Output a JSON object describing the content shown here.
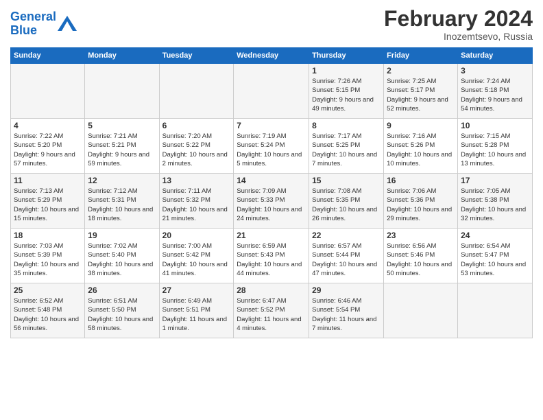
{
  "header": {
    "logo_line1": "General",
    "logo_line2": "Blue",
    "month_title": "February 2024",
    "location": "Inozemtsevo, Russia"
  },
  "weekdays": [
    "Sunday",
    "Monday",
    "Tuesday",
    "Wednesday",
    "Thursday",
    "Friday",
    "Saturday"
  ],
  "weeks": [
    [
      {
        "day": "",
        "info": ""
      },
      {
        "day": "",
        "info": ""
      },
      {
        "day": "",
        "info": ""
      },
      {
        "day": "",
        "info": ""
      },
      {
        "day": "1",
        "info": "Sunrise: 7:26 AM\nSunset: 5:15 PM\nDaylight: 9 hours\nand 49 minutes."
      },
      {
        "day": "2",
        "info": "Sunrise: 7:25 AM\nSunset: 5:17 PM\nDaylight: 9 hours\nand 52 minutes."
      },
      {
        "day": "3",
        "info": "Sunrise: 7:24 AM\nSunset: 5:18 PM\nDaylight: 9 hours\nand 54 minutes."
      }
    ],
    [
      {
        "day": "4",
        "info": "Sunrise: 7:22 AM\nSunset: 5:20 PM\nDaylight: 9 hours\nand 57 minutes."
      },
      {
        "day": "5",
        "info": "Sunrise: 7:21 AM\nSunset: 5:21 PM\nDaylight: 9 hours\nand 59 minutes."
      },
      {
        "day": "6",
        "info": "Sunrise: 7:20 AM\nSunset: 5:22 PM\nDaylight: 10 hours\nand 2 minutes."
      },
      {
        "day": "7",
        "info": "Sunrise: 7:19 AM\nSunset: 5:24 PM\nDaylight: 10 hours\nand 5 minutes."
      },
      {
        "day": "8",
        "info": "Sunrise: 7:17 AM\nSunset: 5:25 PM\nDaylight: 10 hours\nand 7 minutes."
      },
      {
        "day": "9",
        "info": "Sunrise: 7:16 AM\nSunset: 5:26 PM\nDaylight: 10 hours\nand 10 minutes."
      },
      {
        "day": "10",
        "info": "Sunrise: 7:15 AM\nSunset: 5:28 PM\nDaylight: 10 hours\nand 13 minutes."
      }
    ],
    [
      {
        "day": "11",
        "info": "Sunrise: 7:13 AM\nSunset: 5:29 PM\nDaylight: 10 hours\nand 15 minutes."
      },
      {
        "day": "12",
        "info": "Sunrise: 7:12 AM\nSunset: 5:31 PM\nDaylight: 10 hours\nand 18 minutes."
      },
      {
        "day": "13",
        "info": "Sunrise: 7:11 AM\nSunset: 5:32 PM\nDaylight: 10 hours\nand 21 minutes."
      },
      {
        "day": "14",
        "info": "Sunrise: 7:09 AM\nSunset: 5:33 PM\nDaylight: 10 hours\nand 24 minutes."
      },
      {
        "day": "15",
        "info": "Sunrise: 7:08 AM\nSunset: 5:35 PM\nDaylight: 10 hours\nand 26 minutes."
      },
      {
        "day": "16",
        "info": "Sunrise: 7:06 AM\nSunset: 5:36 PM\nDaylight: 10 hours\nand 29 minutes."
      },
      {
        "day": "17",
        "info": "Sunrise: 7:05 AM\nSunset: 5:38 PM\nDaylight: 10 hours\nand 32 minutes."
      }
    ],
    [
      {
        "day": "18",
        "info": "Sunrise: 7:03 AM\nSunset: 5:39 PM\nDaylight: 10 hours\nand 35 minutes."
      },
      {
        "day": "19",
        "info": "Sunrise: 7:02 AM\nSunset: 5:40 PM\nDaylight: 10 hours\nand 38 minutes."
      },
      {
        "day": "20",
        "info": "Sunrise: 7:00 AM\nSunset: 5:42 PM\nDaylight: 10 hours\nand 41 minutes."
      },
      {
        "day": "21",
        "info": "Sunrise: 6:59 AM\nSunset: 5:43 PM\nDaylight: 10 hours\nand 44 minutes."
      },
      {
        "day": "22",
        "info": "Sunrise: 6:57 AM\nSunset: 5:44 PM\nDaylight: 10 hours\nand 47 minutes."
      },
      {
        "day": "23",
        "info": "Sunrise: 6:56 AM\nSunset: 5:46 PM\nDaylight: 10 hours\nand 50 minutes."
      },
      {
        "day": "24",
        "info": "Sunrise: 6:54 AM\nSunset: 5:47 PM\nDaylight: 10 hours\nand 53 minutes."
      }
    ],
    [
      {
        "day": "25",
        "info": "Sunrise: 6:52 AM\nSunset: 5:48 PM\nDaylight: 10 hours\nand 56 minutes."
      },
      {
        "day": "26",
        "info": "Sunrise: 6:51 AM\nSunset: 5:50 PM\nDaylight: 10 hours\nand 58 minutes."
      },
      {
        "day": "27",
        "info": "Sunrise: 6:49 AM\nSunset: 5:51 PM\nDaylight: 11 hours\nand 1 minute."
      },
      {
        "day": "28",
        "info": "Sunrise: 6:47 AM\nSunset: 5:52 PM\nDaylight: 11 hours\nand 4 minutes."
      },
      {
        "day": "29",
        "info": "Sunrise: 6:46 AM\nSunset: 5:54 PM\nDaylight: 11 hours\nand 7 minutes."
      },
      {
        "day": "",
        "info": ""
      },
      {
        "day": "",
        "info": ""
      }
    ]
  ]
}
